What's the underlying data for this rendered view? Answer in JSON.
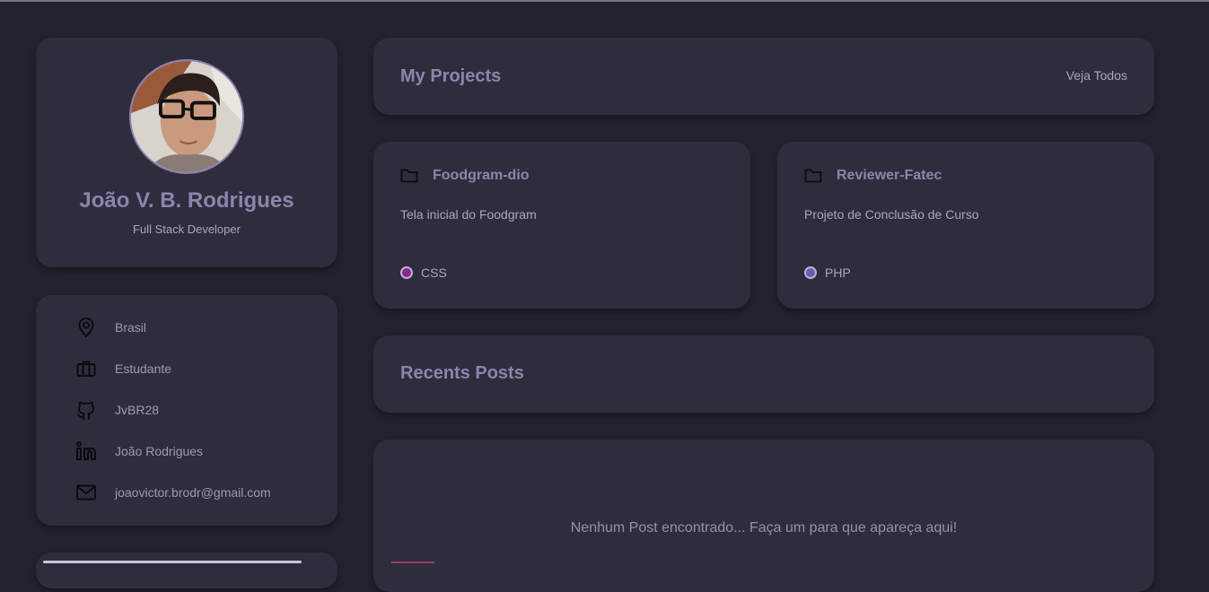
{
  "profile": {
    "name": "João V. B. Rodrigues",
    "role": "Full Stack Developer"
  },
  "info": [
    {
      "icon": "location-pin-icon",
      "label": "Brasil"
    },
    {
      "icon": "briefcase-icon",
      "label": "Estudante"
    },
    {
      "icon": "github-icon",
      "label": "JvBR28"
    },
    {
      "icon": "linkedin-icon",
      "label": "João Rodrigues"
    },
    {
      "icon": "mail-icon",
      "label": "joaovictor.brodr@gmail.com"
    }
  ],
  "projects": {
    "title": "My Projects",
    "see_all": "Veja Todos",
    "items": [
      {
        "name": "Foodgram-dio",
        "description": "Tela inicial do Foodgram",
        "language": "CSS",
        "language_color": "#8e2394"
      },
      {
        "name": "Reviewer-Fatec",
        "description": "Projeto de Conclusão de Curso",
        "language": "PHP",
        "language_color": "#6a5bb5"
      }
    ]
  },
  "posts": {
    "title": "Recents Posts",
    "empty_message": "Nenhum Post encontrado... Faça um para que apareça aqui!"
  },
  "colors": {
    "background": "#24222f",
    "card": "#2f2d3d",
    "accent": "#8f83ad",
    "text": "#a9a6bd"
  }
}
